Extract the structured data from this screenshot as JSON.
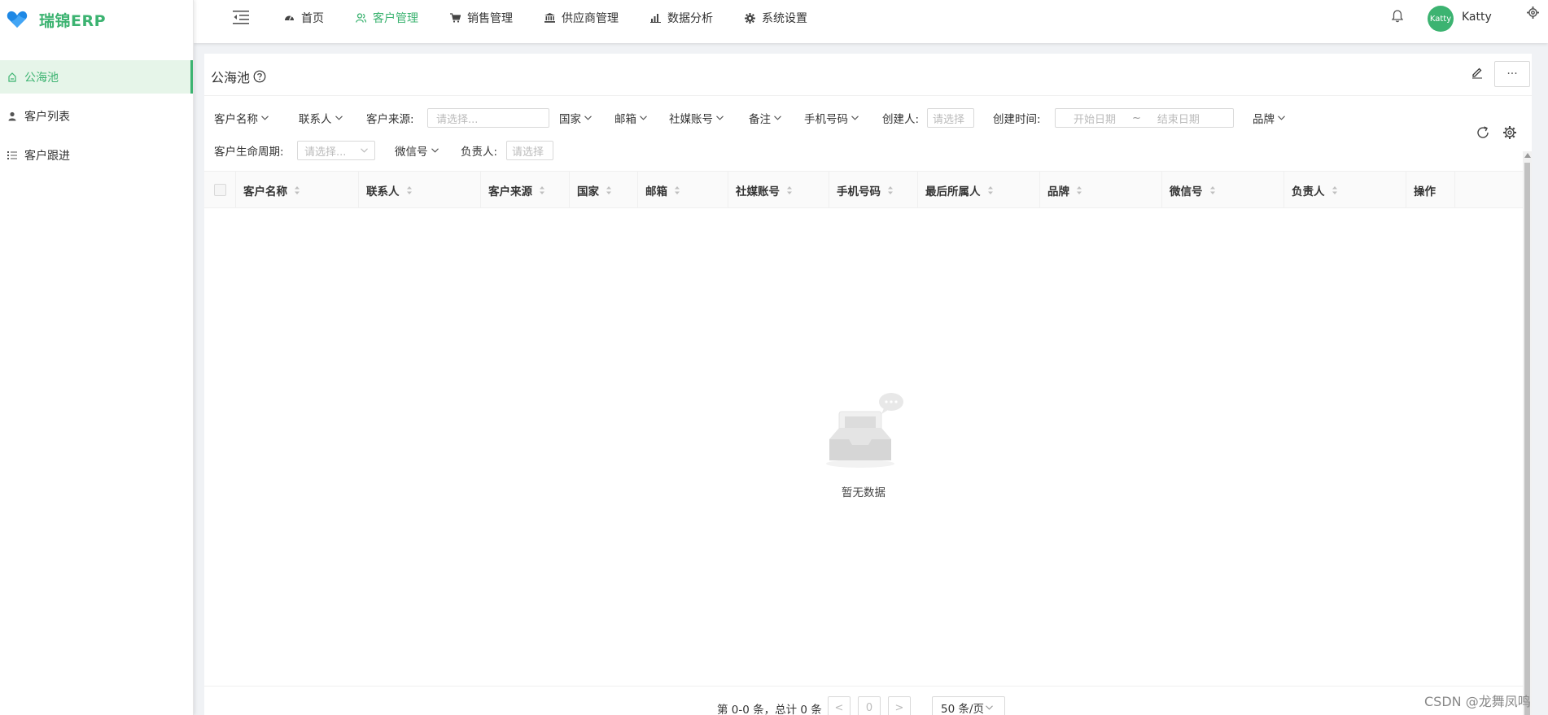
{
  "app": {
    "title": "瑞锦ERP"
  },
  "sidebar": {
    "items": [
      {
        "label": "公海池",
        "icon": "pool-icon",
        "active": true
      },
      {
        "label": "客户列表",
        "icon": "user-icon",
        "active": false
      },
      {
        "label": "客户跟进",
        "icon": "list-icon",
        "active": false
      }
    ]
  },
  "topnav": {
    "items": [
      {
        "label": "首页",
        "icon": "dashboard-icon",
        "active": false
      },
      {
        "label": "客户管理",
        "icon": "users-icon",
        "active": true
      },
      {
        "label": "销售管理",
        "icon": "cart-icon",
        "active": false
      },
      {
        "label": "供应商管理",
        "icon": "bank-icon",
        "active": false
      },
      {
        "label": "数据分析",
        "icon": "bar-chart-icon",
        "active": false
      },
      {
        "label": "系统设置",
        "icon": "gear-icon",
        "active": false
      }
    ],
    "user": {
      "avatar_text": "Katty",
      "name": "Katty"
    }
  },
  "page": {
    "title": "公海池",
    "more_label": "···"
  },
  "filters": {
    "row1": {
      "customer_name": "客户名称",
      "contact": "联系人",
      "source_label": "客户来源:",
      "source_placeholder": "请选择...",
      "country": "国家",
      "email": "邮箱",
      "social": "社媒账号",
      "remark": "备注",
      "phone": "手机号码",
      "creator_label": "创建人:",
      "creator_placeholder": "请选择",
      "created_time_label": "创建时间:",
      "start_date": "开始日期",
      "date_sep": "~",
      "end_date": "结束日期",
      "brand": "品牌"
    },
    "row2": {
      "lifecycle_label": "客户生命周期:",
      "lifecycle_placeholder": "请选择...",
      "wechat": "微信号",
      "owner_label": "负责人:",
      "owner_placeholder": "请选择"
    }
  },
  "table": {
    "columns": [
      "客户名称",
      "联系人",
      "客户来源",
      "国家",
      "邮箱",
      "社媒账号",
      "手机号码",
      "最后所属人",
      "品牌",
      "微信号",
      "负责人",
      "操作"
    ],
    "rows": [],
    "empty_text": "暂无数据"
  },
  "pagination": {
    "total_text": "第 0-0 条，总计 0 条",
    "prev": "<",
    "page": "0",
    "next": ">",
    "page_size": "50 条/页"
  },
  "watermark": "CSDN @龙舞凤鸣",
  "colors": {
    "accent": "#3cb371",
    "active_bg": "#e6f5e9"
  }
}
